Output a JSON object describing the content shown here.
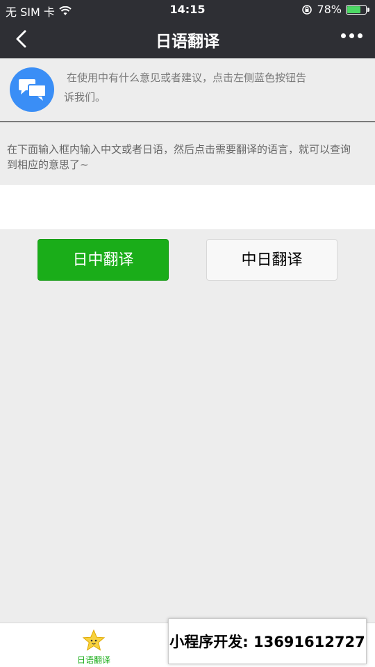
{
  "status_bar": {
    "carrier": "无 SIM 卡",
    "time": "14:15",
    "battery_percent": "78%",
    "battery_level": 0.78,
    "icons": [
      "wifi-icon",
      "rotation-lock-icon",
      "battery-icon"
    ]
  },
  "nav": {
    "title": "日语翻译",
    "back_icon": "back-chevron-icon",
    "more_icon": "more-dots-icon"
  },
  "feedback": {
    "icon": "chat-bubbles-icon",
    "line1": "在使用中有什么意见或者建议，点击左侧蓝色按钮告",
    "line2": "诉我们。"
  },
  "instruction": {
    "line1": "在下面输入框内输入中文或者日语，然后点击需要翻译的语言，就可以查询",
    "line2": "到相应的意思了~"
  },
  "input": {
    "value": "",
    "placeholder": ""
  },
  "buttons": {
    "ja_to_zh": "日中翻译",
    "zh_to_ja": "中日翻译"
  },
  "tab_bar": {
    "tab_label": "日语翻译",
    "tab_icon": "star-icon"
  },
  "watermark": {
    "text": "小程序开发: 13691612727"
  },
  "colors": {
    "header": "#2e2f34",
    "accent_green": "#1aad19",
    "feedback_blue": "#3a8ef6",
    "background": "#ededed"
  }
}
